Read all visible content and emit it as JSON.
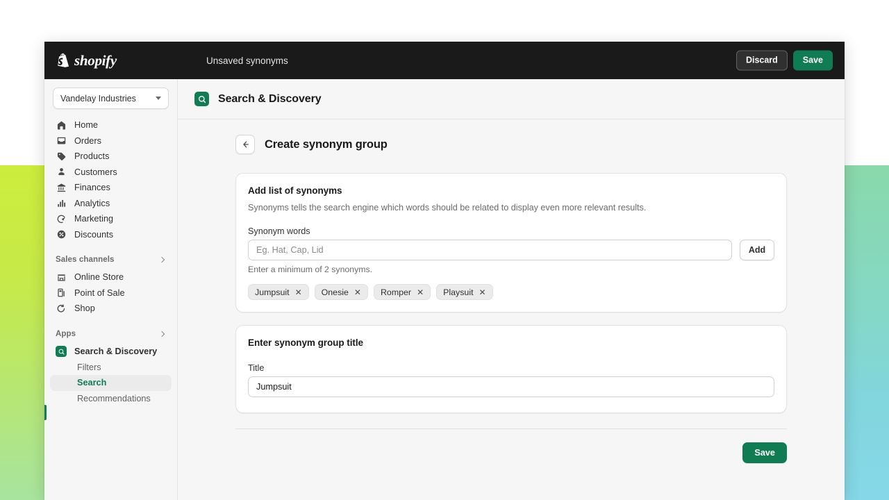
{
  "topbar": {
    "brand": "shopify",
    "brand_icon": "shopify-bag-icon",
    "unsaved_label": "Unsaved synonyms",
    "discard_label": "Discard",
    "save_label": "Save"
  },
  "sidebar": {
    "store_switcher": {
      "name": "Vandelay Industries",
      "icon": "chevron-down-icon"
    },
    "nav": [
      {
        "label": "Home",
        "icon": "home-icon"
      },
      {
        "label": "Orders",
        "icon": "orders-inbox-icon"
      },
      {
        "label": "Products",
        "icon": "product-tag-icon"
      },
      {
        "label": "Customers",
        "icon": "person-icon"
      },
      {
        "label": "Finances",
        "icon": "bank-icon"
      },
      {
        "label": "Analytics",
        "icon": "bar-chart-icon"
      },
      {
        "label": "Marketing",
        "icon": "megaphone-target-icon"
      },
      {
        "label": "Discounts",
        "icon": "discount-percent-icon"
      }
    ],
    "sections": [
      {
        "label": "Sales channels",
        "icon": "chevron-right-icon",
        "items": [
          {
            "label": "Online Store",
            "icon": "storefront-icon"
          },
          {
            "label": "Point of Sale",
            "icon": "pos-device-icon"
          },
          {
            "label": "Shop",
            "icon": "shop-circle-icon"
          }
        ]
      },
      {
        "label": "Apps",
        "icon": "chevron-right-icon",
        "app": {
          "label": "Search & Discovery",
          "icon": "search-discovery-app-icon"
        },
        "sub_items": [
          {
            "label": "Filters",
            "active": false
          },
          {
            "label": "Search",
            "active": true
          },
          {
            "label": "Recommendations",
            "active": false
          }
        ]
      }
    ]
  },
  "app_header": {
    "title": "Search & Discovery",
    "icon": "search-discovery-app-icon"
  },
  "page": {
    "back_icon": "arrow-left-icon",
    "title": "Create synonym group"
  },
  "synonyms_card": {
    "heading": "Add list of synonyms",
    "description": "Synonyms tells the search engine which words should be related to display even more relevant results.",
    "field_label": "Synonym words",
    "input_value": "",
    "input_placeholder": "Eg. Hat, Cap, Lid",
    "add_label": "Add",
    "help_text": "Enter a minimum of 2 synonyms.",
    "chips": [
      {
        "label": "Jumpsuit",
        "remove_icon": "close-icon"
      },
      {
        "label": "Onesie",
        "remove_icon": "close-icon"
      },
      {
        "label": "Romper",
        "remove_icon": "close-icon"
      },
      {
        "label": "Playsuit",
        "remove_icon": "close-icon"
      }
    ]
  },
  "title_card": {
    "heading": "Enter synonym group title",
    "field_label": "Title",
    "input_value": "Jumpsuit",
    "input_placeholder": ""
  },
  "footer": {
    "save_label": "Save"
  },
  "colors": {
    "brand_green": "#0f7c54",
    "topbar_black": "#1a1a1a",
    "surface": "#f6f6f7",
    "card": "#ffffff",
    "border": "#e1e1e1",
    "gradient_left_start": "#cdec3c",
    "gradient_left_end": "#a8e4a0",
    "gradient_right_start": "#8ad9ab",
    "gradient_right_end": "#86d8e8"
  }
}
